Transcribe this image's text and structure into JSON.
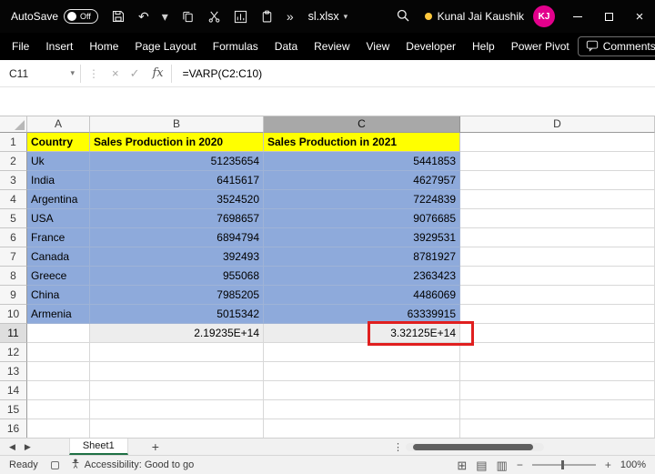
{
  "titlebar": {
    "autosave_label": "AutoSave",
    "autosave_state": "Off",
    "filename": "sl.xlsx",
    "user_name": "Kunal Jai Kaushik",
    "user_initials": "KJ",
    "avatar_color": "#E3008C",
    "presence_color": "#FFC83D"
  },
  "menubar": {
    "tabs": [
      "File",
      "Insert",
      "Home",
      "Page Layout",
      "Formulas",
      "Data",
      "Review",
      "View",
      "Developer",
      "Help",
      "Power Pivot"
    ],
    "comments_label": "Comments"
  },
  "formula_bar": {
    "name_box": "C11",
    "fx_label": "fx",
    "formula": "=VARP(C2:C10)"
  },
  "grid": {
    "column_headers": [
      "A",
      "B",
      "C",
      "D"
    ],
    "selected_column": "C",
    "active_row": 11,
    "active_cell": "C11",
    "colors": {
      "header_fill": "#FFFF00",
      "data_fill": "#8EAADB",
      "result_fill": "#EDEDED",
      "annotation": "#E01F1F"
    },
    "rows": [
      {
        "num": 1,
        "style": "header",
        "a": "Country",
        "b": "Sales Production in 2020",
        "c": "Sales Production in 2021",
        "d": ""
      },
      {
        "num": 2,
        "style": "data",
        "a": "Uk",
        "b": "51235654",
        "c": "5441853",
        "d": ""
      },
      {
        "num": 3,
        "style": "data",
        "a": "India",
        "b": "6415617",
        "c": "4627957",
        "d": ""
      },
      {
        "num": 4,
        "style": "data",
        "a": "Argentina",
        "b": "3524520",
        "c": "7224839",
        "d": ""
      },
      {
        "num": 5,
        "style": "data",
        "a": "USA",
        "b": "7698657",
        "c": "9076685",
        "d": ""
      },
      {
        "num": 6,
        "style": "data",
        "a": "France",
        "b": "6894794",
        "c": "3929531",
        "d": ""
      },
      {
        "num": 7,
        "style": "data",
        "a": "Canada",
        "b": "392493",
        "c": "8781927",
        "d": ""
      },
      {
        "num": 8,
        "style": "data",
        "a": "Greece",
        "b": "955068",
        "c": "2363423",
        "d": ""
      },
      {
        "num": 9,
        "style": "data",
        "a": "China",
        "b": "7985205",
        "c": "4486069",
        "d": ""
      },
      {
        "num": 10,
        "style": "data",
        "a": "Armenia",
        "b": "5015342",
        "c": "63339915",
        "d": ""
      },
      {
        "num": 11,
        "style": "result",
        "a": "",
        "b": "2.19235E+14",
        "c": "3.32125E+14",
        "d": ""
      },
      {
        "num": 12,
        "style": "empty",
        "a": "",
        "b": "",
        "c": "",
        "d": ""
      },
      {
        "num": 13,
        "style": "empty",
        "a": "",
        "b": "",
        "c": "",
        "d": ""
      },
      {
        "num": 14,
        "style": "empty",
        "a": "",
        "b": "",
        "c": "",
        "d": ""
      },
      {
        "num": 15,
        "style": "empty",
        "a": "",
        "b": "",
        "c": "",
        "d": ""
      },
      {
        "num": 16,
        "style": "empty",
        "a": "",
        "b": "",
        "c": "",
        "d": ""
      }
    ]
  },
  "sheet_bar": {
    "sheet_name": "Sheet1"
  },
  "status_bar": {
    "ready_label": "Ready",
    "accessibility_label": "Accessibility: Good to go",
    "zoom_level": "100%"
  },
  "glyphs": {
    "undo": "↶",
    "dropdown": "▾",
    "more_commands": "»",
    "vertical_dots": "⋮",
    "cancel": "×",
    "enter": "✓",
    "prev_sheet": "◀",
    "next_sheet": "▶",
    "add_sheet": "+",
    "close_window": "×",
    "normal_view": "⊞",
    "page_layout_view": "▤",
    "page_break_view": "▥",
    "zoom_out": "−",
    "zoom_in": "+"
  }
}
